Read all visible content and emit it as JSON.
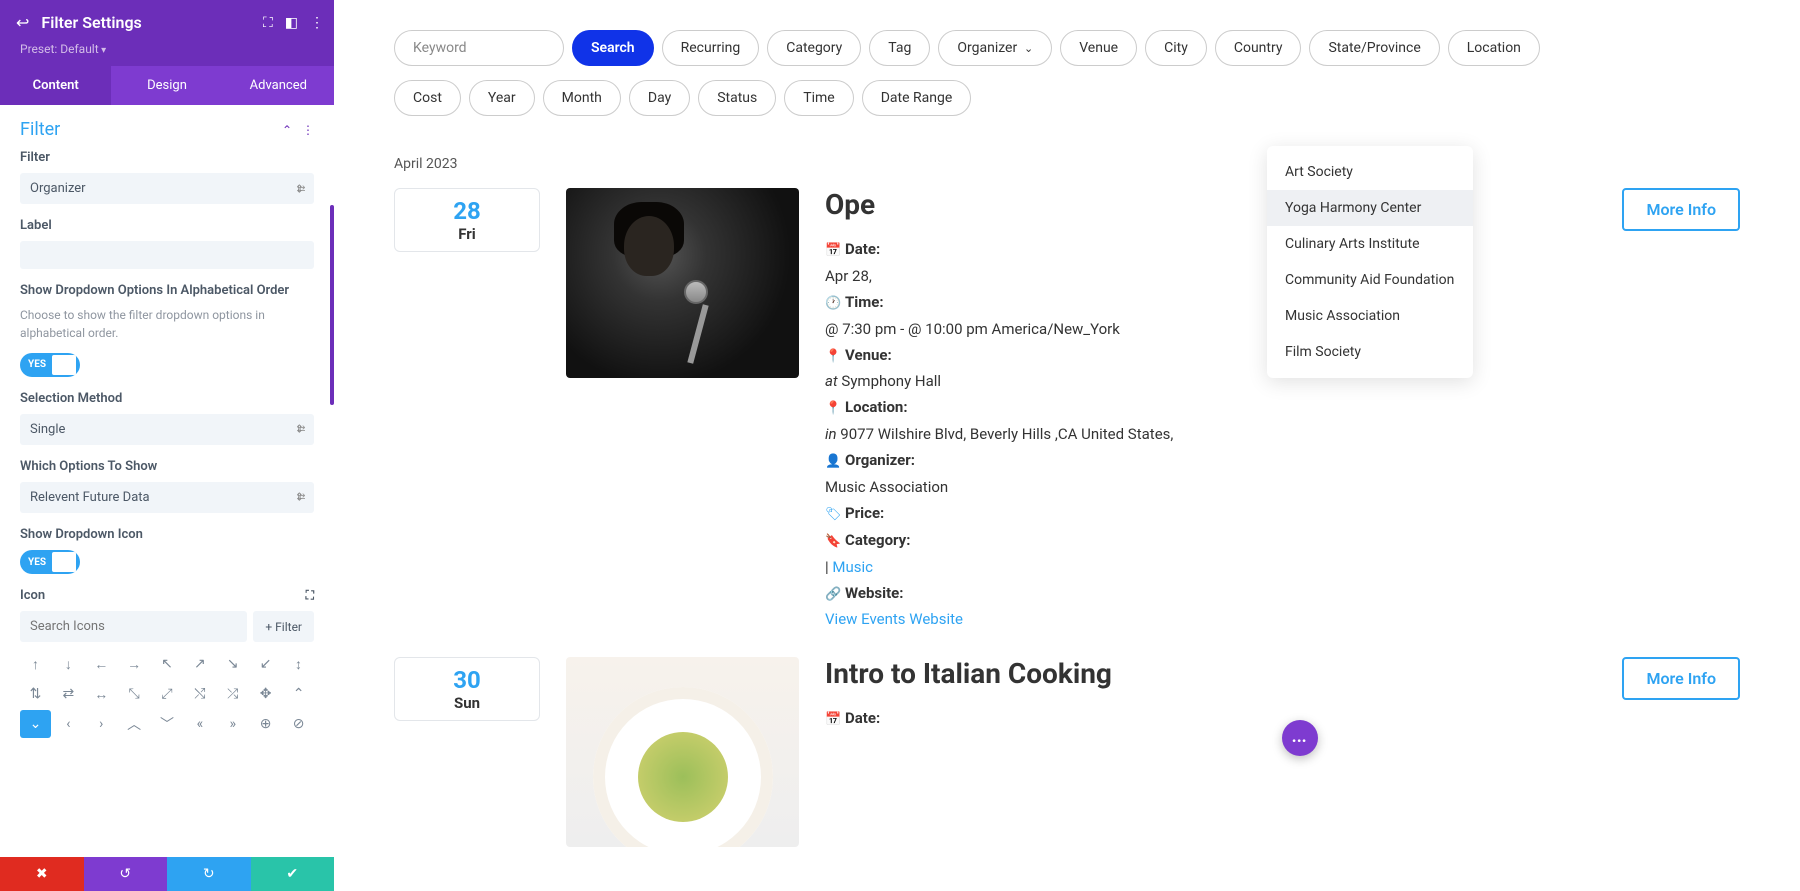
{
  "sidebar": {
    "title": "Filter Settings",
    "preset": "Preset: Default",
    "tabs": [
      {
        "label": "Content",
        "active": true
      },
      {
        "label": "Design",
        "active": false
      },
      {
        "label": "Advanced",
        "active": false
      }
    ],
    "section_title": "Filter",
    "fields": {
      "filter_label": "Filter",
      "filter_value": "Organizer",
      "label_label": "Label",
      "label_value": "",
      "alpha_label": "Show Dropdown Options In Alphabetical Order",
      "alpha_desc": "Choose to show the filter dropdown options in alphabetical order.",
      "toggle_yes": "YES",
      "selection_label": "Selection Method",
      "selection_value": "Single",
      "which_label": "Which Options To Show",
      "which_value": "Relevent Future Data",
      "show_icon_label": "Show Dropdown Icon",
      "icon_label": "Icon",
      "icon_search_placeholder": "Search Icons",
      "icon_filter_btn": "+  Filter"
    }
  },
  "main": {
    "search_placeholder": "Keyword",
    "filters_row1": [
      "Search",
      "Recurring",
      "Category",
      "Tag",
      "Organizer",
      "Venue",
      "City",
      "Country",
      "State/Province",
      "Location"
    ],
    "filters_row2": [
      "Cost",
      "Year",
      "Month",
      "Day",
      "Status",
      "Time",
      "Date Range"
    ],
    "dropdown": [
      {
        "label": "Art Society"
      },
      {
        "label": "Yoga Harmony Center"
      },
      {
        "label": "Culinary Arts Institute"
      },
      {
        "label": "Community Aid Foundation"
      },
      {
        "label": "Music Association"
      },
      {
        "label": "Film Society"
      }
    ],
    "month_header": "April 2023",
    "more_info": "More Info",
    "events": [
      {
        "date_num": "28",
        "date_day": "Fri",
        "title": "Ope",
        "meta": {
          "date_label": "Date:",
          "date_val": "Apr 28,",
          "time_label": "Time:",
          "time_val": "@ 7:30 pm - @ 10:00 pm America/New_York",
          "venue_label": "Venue:",
          "venue_at": "at",
          "venue_val": " Symphony Hall",
          "location_label": "Location:",
          "location_in": "in",
          "location_val": " 9077 Wilshire Blvd, Beverly Hills ,CA United States,",
          "organizer_label": "Organizer:",
          "organizer_val": "Music Association",
          "price_label": "Price:",
          "category_label": "Category:",
          "category_prefix": "| ",
          "category_val": "Music",
          "website_label": "Website:",
          "website_link": "View Events Website"
        }
      },
      {
        "date_num": "30",
        "date_day": "Sun",
        "title": "Intro to Italian Cooking",
        "meta": {
          "date_label": "Date:"
        }
      }
    ]
  }
}
